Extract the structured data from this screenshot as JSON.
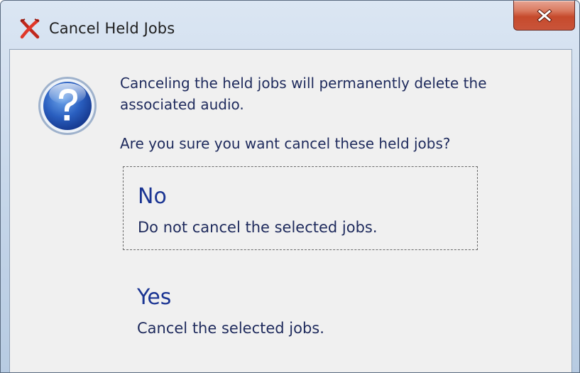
{
  "window": {
    "title": "Cancel Held Jobs"
  },
  "dialog": {
    "message": "Canceling the held jobs will permanently delete the associated audio.",
    "question": "Are you sure you want cancel these held jobs?"
  },
  "options": [
    {
      "title": "No",
      "description": "Do not cancel the selected jobs."
    },
    {
      "title": "Yes",
      "description": "Cancel the selected jobs."
    }
  ],
  "icons": {
    "app": "cancel-jobs-icon",
    "close": "close-icon",
    "dialog": "question-icon"
  },
  "colors": {
    "close_button": "#c64a2c",
    "link_text": "#1b3593",
    "body_text": "#1e2a5c",
    "client_bg": "#f0f0f0"
  }
}
